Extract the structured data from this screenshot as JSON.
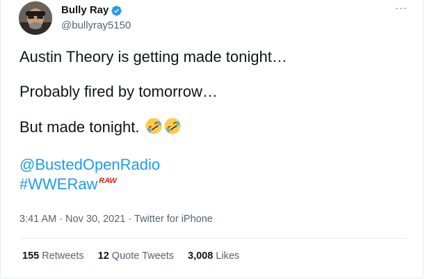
{
  "author": {
    "name": "Bully Ray",
    "handle": "@bullyray5150"
  },
  "more_label": "···",
  "tweet": {
    "lines": [
      "Austin Theory is getting made tonight…",
      "Probably fired by tomorrow…",
      "But made tonight."
    ],
    "mention": "@BustedOpenRadio",
    "hashtag": "#WWERaw",
    "hashflag_text": "RAW",
    "emoji": "rolling-on-floor-laughing-icon"
  },
  "meta": {
    "time": "3:41 AM",
    "separator": "·",
    "date": "Nov 30, 2021",
    "source": "Twitter for iPhone"
  },
  "stats": {
    "retweets_count": "155",
    "retweets_label": "Retweets",
    "quotes_count": "12",
    "quotes_label": "Quote Tweets",
    "likes_count": "3,008",
    "likes_label": "Likes"
  },
  "colors": {
    "link": "#1d9bf0",
    "text": "#0f1419",
    "secondary": "#536471",
    "verified": "#1d9bf0",
    "raw_red": "#d9201f"
  }
}
